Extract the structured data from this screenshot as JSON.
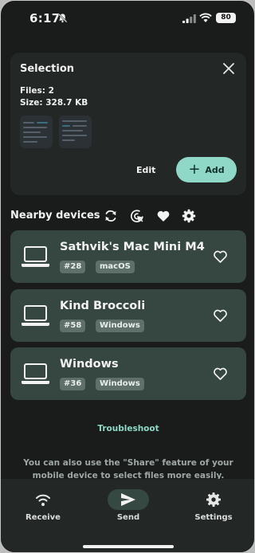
{
  "status_bar": {
    "time": "6:17",
    "battery": "80"
  },
  "selection": {
    "title": "Selection",
    "files": "Files: 2",
    "size": "Size: 328.7 KB",
    "edit_label": "Edit",
    "add_label": "Add"
  },
  "nearby": {
    "title": "Nearby devices"
  },
  "devices": [
    {
      "name": "Sathvik's Mac Mini M4",
      "id": "#28",
      "os": "macOS"
    },
    {
      "name": "Kind Broccoli",
      "id": "#58",
      "os": "Windows"
    },
    {
      "name": "Windows",
      "id": "#36",
      "os": "Windows"
    }
  ],
  "troubleshoot": "Troubleshoot",
  "tip": "You can also use the \"Share\" feature of your mobile device to select files more easily.",
  "nav": {
    "receive": "Receive",
    "send": "Send",
    "settings": "Settings"
  },
  "colors": {
    "background": "#191c1a",
    "card": "#364742",
    "accent": "#8fd8c8"
  },
  "icons": [
    "bell-slash-icon",
    "signal-icon",
    "wifi-icon",
    "battery-icon",
    "close-icon",
    "refresh-icon",
    "target-icon",
    "heart-icon",
    "gear-icon",
    "laptop-icon",
    "send-icon"
  ]
}
